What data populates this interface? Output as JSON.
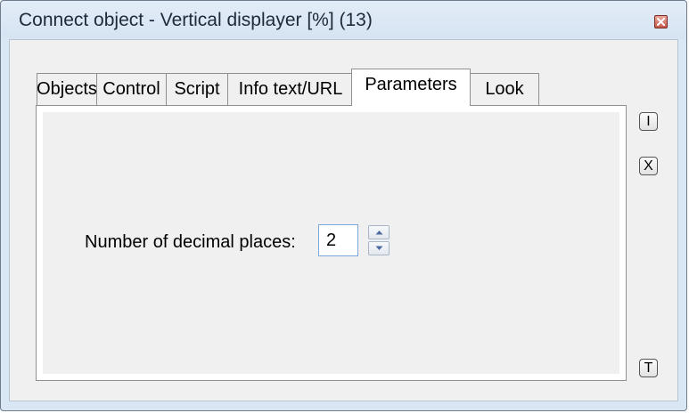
{
  "window": {
    "title": "Connect object - Vertical displayer [%] (13)"
  },
  "tabs": [
    {
      "label": "Objects",
      "active": false
    },
    {
      "label": "Control",
      "active": false
    },
    {
      "label": "Script",
      "active": false
    },
    {
      "label": "Info text/URL",
      "active": false
    },
    {
      "label": "Parameters",
      "active": true
    },
    {
      "label": "Look",
      "active": false
    }
  ],
  "parameters": {
    "decimal_places_label": "Number of decimal places:",
    "decimal_places_value": "2"
  },
  "side_buttons": {
    "button1_label": "I",
    "button2_label": "X",
    "button3_label": "T"
  },
  "colors": {
    "title_bar": "#d9e6f4",
    "close_button": "#c6594a",
    "client_background": "#f0f0f0"
  }
}
